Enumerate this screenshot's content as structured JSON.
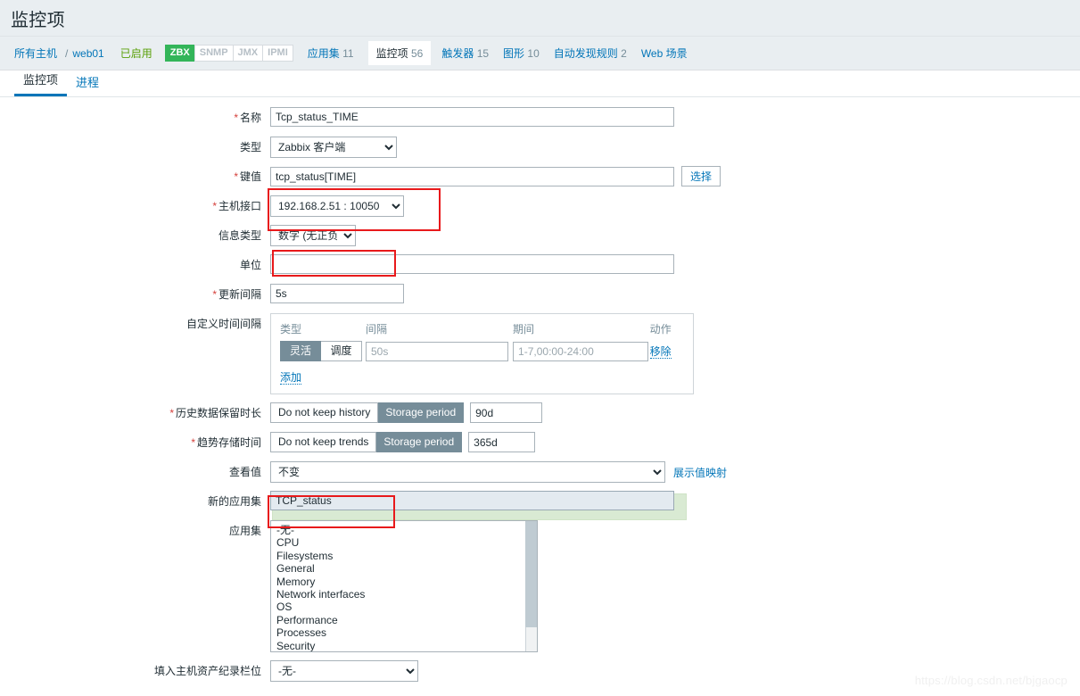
{
  "header": {
    "title": "监控项"
  },
  "breadcrumb": {
    "all_hosts": "所有主机",
    "separator": "/",
    "host": "web01",
    "status": "已启用",
    "protocols": [
      {
        "label": "ZBX",
        "active": true
      },
      {
        "label": "SNMP",
        "active": false
      },
      {
        "label": "JMX",
        "active": false
      },
      {
        "label": "IPMI",
        "active": false
      }
    ],
    "tabs": [
      {
        "label": "应用集",
        "count": "11",
        "selected": false
      },
      {
        "label": "监控项",
        "count": "56",
        "selected": true
      },
      {
        "label": "触发器",
        "count": "15",
        "selected": false
      },
      {
        "label": "图形",
        "count": "10",
        "selected": false
      },
      {
        "label": "自动发现规则",
        "count": "2",
        "selected": false
      },
      {
        "label": "Web 场景",
        "count": "",
        "selected": false
      }
    ]
  },
  "subtabs": [
    {
      "label": "监控项",
      "active": true
    },
    {
      "label": "进程",
      "active": false
    }
  ],
  "form": {
    "name": {
      "label": "名称",
      "required": true,
      "value": "Tcp_status_TIME"
    },
    "type": {
      "label": "类型",
      "required": false,
      "value": "Zabbix 客户端"
    },
    "key": {
      "label": "键值",
      "required": true,
      "value": "tcp_status[TIME]",
      "select_button": "选择"
    },
    "host_interface": {
      "label": "主机接口",
      "required": true,
      "value": "192.168.2.51 : 10050"
    },
    "info_type": {
      "label": "信息类型",
      "required": false,
      "value": "数字 (无正负)"
    },
    "units": {
      "label": "单位",
      "required": false,
      "value": ""
    },
    "update_interval": {
      "label": "更新间隔",
      "required": true,
      "value": "5s"
    },
    "custom_intervals": {
      "label": "自定义时间间隔",
      "columns": [
        "类型",
        "间隔",
        "期间",
        "动作"
      ],
      "rows": [
        {
          "type_flexible": "灵活",
          "type_scheduling": "调度",
          "type_selected": "灵活",
          "interval_placeholder": "50s",
          "interval_value": "",
          "period_placeholder": "1-7,00:00-24:00",
          "period_value": "",
          "action": "移除"
        }
      ],
      "add_label": "添加"
    },
    "history": {
      "label": "历史数据保留时长",
      "required": true,
      "option_off": "Do not keep history",
      "option_on": "Storage period",
      "selected": "Storage period",
      "value": "90d"
    },
    "trends": {
      "label": "趋势存储时间",
      "required": true,
      "option_off": "Do not keep trends",
      "option_on": "Storage period",
      "selected": "Storage period",
      "value": "365d"
    },
    "value_map": {
      "label": "查看值",
      "value": "不变",
      "link": "展示值映射"
    },
    "new_application": {
      "label": "新的应用集",
      "value": "TCP_status"
    },
    "applications": {
      "label": "应用集",
      "options": [
        "-无-",
        "CPU",
        "Filesystems",
        "General",
        "Memory",
        "Network interfaces",
        "OS",
        "Performance",
        "Processes",
        "Security"
      ]
    },
    "inventory_field": {
      "label": "填入主机资产纪录栏位",
      "value": "-无-"
    }
  },
  "watermark": "https://blog.csdn.net/bjgaocp"
}
